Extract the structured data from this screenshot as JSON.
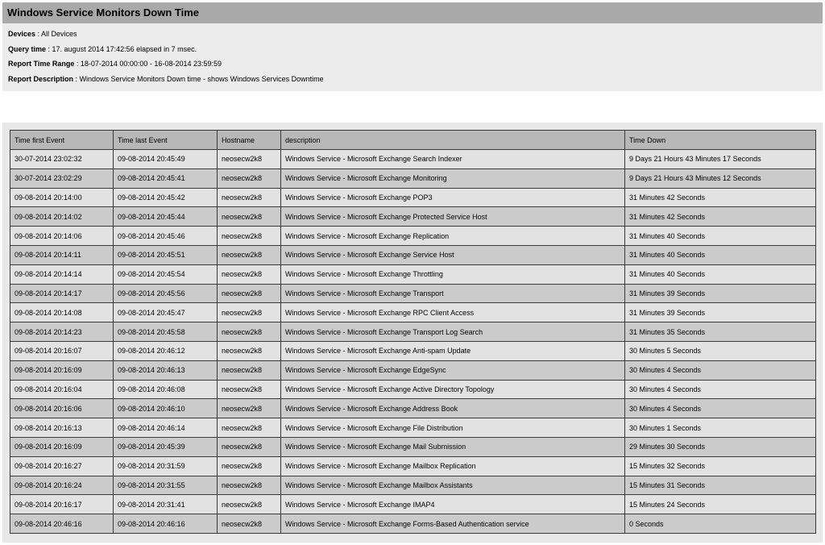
{
  "report": {
    "title": "Windows Service Monitors Down Time",
    "devices_label": "Devices",
    "devices_value": " : All Devices",
    "query_time_label": "Query time",
    "query_time_value": " : 17. august 2014 17:42:56 elapsed in 7 msec.",
    "time_range_label": "Report Time Range",
    "time_range_value": " : 18-07-2014 00:00:00 - 16-08-2014 23:59:59",
    "description_label": "Report Description",
    "description_value": " : Windows Service Monitors Down time - shows Windows Services Downtime"
  },
  "table": {
    "columns": [
      "Time first Event",
      "Time last Event",
      "Hostname",
      "description",
      "Time Down"
    ],
    "rows": [
      [
        "30-07-2014 23:02:32",
        "09-08-2014 20:45:49",
        "neosecw2k8",
        "Windows Service - Microsoft Exchange Search Indexer",
        "9 Days 21 Hours 43 Minutes 17 Seconds"
      ],
      [
        "30-07-2014 23:02:29",
        "09-08-2014 20:45:41",
        "neosecw2k8",
        "Windows Service - Microsoft Exchange Monitoring",
        "9 Days 21 Hours 43 Minutes 12 Seconds"
      ],
      [
        "09-08-2014 20:14:00",
        "09-08-2014 20:45:42",
        "neosecw2k8",
        "Windows Service - Microsoft Exchange POP3",
        "31 Minutes 42 Seconds"
      ],
      [
        "09-08-2014 20:14:02",
        "09-08-2014 20:45:44",
        "neosecw2k8",
        "Windows Service - Microsoft Exchange Protected Service Host",
        "31 Minutes 42 Seconds"
      ],
      [
        "09-08-2014 20:14:06",
        "09-08-2014 20:45:46",
        "neosecw2k8",
        "Windows Service - Microsoft Exchange Replication",
        "31 Minutes 40 Seconds"
      ],
      [
        "09-08-2014 20:14:11",
        "09-08-2014 20:45:51",
        "neosecw2k8",
        "Windows Service - Microsoft Exchange Service Host",
        "31 Minutes 40 Seconds"
      ],
      [
        "09-08-2014 20:14:14",
        "09-08-2014 20:45:54",
        "neosecw2k8",
        "Windows Service - Microsoft Exchange Throttling",
        "31 Minutes 40 Seconds"
      ],
      [
        "09-08-2014 20:14:17",
        "09-08-2014 20:45:56",
        "neosecw2k8",
        "Windows Service - Microsoft Exchange Transport",
        "31 Minutes 39 Seconds"
      ],
      [
        "09-08-2014 20:14:08",
        "09-08-2014 20:45:47",
        "neosecw2k8",
        "Windows Service - Microsoft Exchange RPC Client Access",
        "31 Minutes 39 Seconds"
      ],
      [
        "09-08-2014 20:14:23",
        "09-08-2014 20:45:58",
        "neosecw2k8",
        "Windows Service - Microsoft Exchange Transport Log Search",
        "31 Minutes 35 Seconds"
      ],
      [
        "09-08-2014 20:16:07",
        "09-08-2014 20:46:12",
        "neosecw2k8",
        "Windows Service - Microsoft Exchange Anti-spam Update",
        "30 Minutes 5 Seconds"
      ],
      [
        "09-08-2014 20:16:09",
        "09-08-2014 20:46:13",
        "neosecw2k8",
        "Windows Service - Microsoft Exchange EdgeSync",
        "30 Minutes 4 Seconds"
      ],
      [
        "09-08-2014 20:16:04",
        "09-08-2014 20:46:08",
        "neosecw2k8",
        "Windows Service - Microsoft Exchange Active Directory Topology",
        "30 Minutes 4 Seconds"
      ],
      [
        "09-08-2014 20:16:06",
        "09-08-2014 20:46:10",
        "neosecw2k8",
        "Windows Service - Microsoft Exchange Address Book",
        "30 Minutes 4 Seconds"
      ],
      [
        "09-08-2014 20:16:13",
        "09-08-2014 20:46:14",
        "neosecw2k8",
        "Windows Service - Microsoft Exchange File Distribution",
        "30 Minutes 1 Seconds"
      ],
      [
        "09-08-2014 20:16:09",
        "09-08-2014 20:45:39",
        "neosecw2k8",
        "Windows Service - Microsoft Exchange Mail Submission",
        "29 Minutes 30 Seconds"
      ],
      [
        "09-08-2014 20:16:27",
        "09-08-2014 20:31:59",
        "neosecw2k8",
        "Windows Service - Microsoft Exchange Mailbox Replication",
        "15 Minutes 32 Seconds"
      ],
      [
        "09-08-2014 20:16:24",
        "09-08-2014 20:31:55",
        "neosecw2k8",
        "Windows Service - Microsoft Exchange Mailbox Assistants",
        "15 Minutes 31 Seconds"
      ],
      [
        "09-08-2014 20:16:17",
        "09-08-2014 20:31:41",
        "neosecw2k8",
        "Windows Service - Microsoft Exchange IMAP4",
        "15 Minutes 24 Seconds"
      ],
      [
        "09-08-2014 20:46:16",
        "09-08-2014 20:46:16",
        "neosecw2k8",
        "Windows Service - Microsoft Exchange Forms-Based Authentication service",
        "0 Seconds"
      ]
    ]
  }
}
